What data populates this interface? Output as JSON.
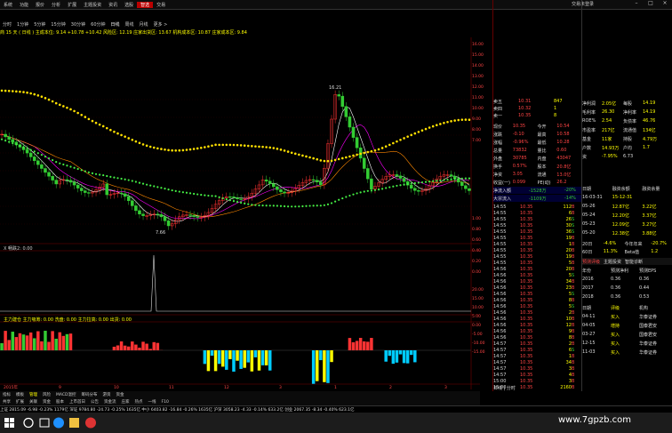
{
  "menu": [
    "系统",
    "功能",
    "报价",
    "分析",
    "扩展",
    "主题投资",
    "资讯",
    "选股",
    "智选",
    "交易"
  ],
  "menu_active_index": 8,
  "window_title": "交易未登录",
  "period_tabs": [
    "分时",
    "1分钟",
    "5分钟",
    "15分钟",
    "30分钟",
    "60分钟",
    "日线",
    "周线",
    "月线",
    "更多 >"
  ],
  "period_active_index": 6,
  "indicator_line": "商 15 天 ( 日线 ) 主成本位: 9.14  +10.78  +10.42  风险区: 12.19  庄家出货区: 13.67  机构成本区: 10.87  庄家成本区: 9.84",
  "price_labels": {
    "high": "16.21",
    "low": "7.66"
  },
  "sub1_title": "X 畅跌2: 0.00",
  "sub2_title": "主力建仓  主力吸筹: 0.00  洗盘: 0.00          主力拉高: 0.00  出货: 0.00",
  "date_axis": [
    "2015年",
    "9",
    "10",
    "11",
    "12",
    "3",
    "1",
    "2",
    "3"
  ],
  "right_axis_ticks": [
    "16.00",
    "15.00",
    "14.00",
    "13.00",
    "12.00",
    "11.00",
    "10.00",
    "9.00",
    "8.00",
    "7.00",
    "1.00",
    "0.80",
    "0.60",
    "0.40",
    "0.20",
    "0.00",
    "20.00",
    "15.00",
    "10.00",
    "5.00",
    "0.00",
    "-5.00",
    "-10.00",
    "-15.00"
  ],
  "quote": {
    "sell_rows": [
      {
        "label": "卖五",
        "price": "10.31",
        "vol": "847"
      },
      {
        "label": "卖四",
        "price": "10.32",
        "vol": "1"
      },
      {
        "label": "卖一",
        "price": "10.35",
        "vol": "8"
      }
    ],
    "info": [
      [
        "现价",
        "10.35",
        "今开",
        "10.54"
      ],
      [
        "涨跌",
        "-0.10",
        "最高",
        "10.58"
      ],
      [
        "涨幅",
        "-0.96%",
        "最低",
        "10.28"
      ],
      [
        "总量",
        "73832",
        "量比",
        "0.60"
      ],
      [
        "外盘",
        "30785",
        "内盘",
        "43047"
      ],
      [
        "换手",
        "0.57%",
        "股本",
        "20.8亿"
      ],
      [
        "净资",
        "3.05",
        "流通",
        "13.0亿"
      ],
      [
        "收益(一)",
        "0.099",
        "PE(动)",
        "26.2"
      ]
    ],
    "flows": [
      {
        "label": "净流入额",
        "value": "-1528万",
        "pct": "-20%"
      },
      {
        "label": "大宗流入",
        "value": "-1109万",
        "pct": "-14%"
      }
    ],
    "ticks": [
      [
        "14:55",
        "10.35",
        "112",
        "B"
      ],
      [
        "14:55",
        "10.35",
        "6",
        "B"
      ],
      [
        "14:55",
        "10.35",
        "26",
        "S"
      ],
      [
        "14:55",
        "10.35",
        "30",
        "S"
      ],
      [
        "14:55",
        "10.35",
        "36",
        "S"
      ],
      [
        "14:55",
        "10.35",
        "19",
        "B"
      ],
      [
        "14:55",
        "10.35",
        "1",
        "B"
      ],
      [
        "14:55",
        "10.35",
        "20",
        "B"
      ],
      [
        "14:55",
        "10.35",
        "19",
        "B"
      ],
      [
        "14:55",
        "10.35",
        "5",
        "B"
      ],
      [
        "14:56",
        "10.35",
        "20",
        "B"
      ],
      [
        "14:56",
        "10.35",
        "5",
        "S"
      ],
      [
        "14:56",
        "10.35",
        "34",
        "B"
      ],
      [
        "14:56",
        "10.35",
        "23",
        "B"
      ],
      [
        "14:56",
        "10.35",
        "5",
        "S"
      ],
      [
        "14:56",
        "10.35",
        "8",
        "B"
      ],
      [
        "14:56",
        "10.35",
        "5",
        "S"
      ],
      [
        "14:56",
        "10.35",
        "2",
        "B"
      ],
      [
        "14:56",
        "10.35",
        "10",
        "B"
      ],
      [
        "14:56",
        "10.35",
        "12",
        "B"
      ],
      [
        "14:56",
        "10.35",
        "9",
        "B"
      ],
      [
        "14:56",
        "10.35",
        "8",
        "B"
      ],
      [
        "14:57",
        "10.35",
        "2",
        "B"
      ],
      [
        "14:57",
        "10.35",
        "6",
        "S"
      ],
      [
        "14:57",
        "10.35",
        "1",
        "B"
      ],
      [
        "14:57",
        "10.35",
        "34",
        "B"
      ],
      [
        "14:57",
        "10.35",
        "3",
        "B"
      ],
      [
        "14:57",
        "10.35",
        "4",
        "B"
      ],
      [
        "15:00",
        "10.35",
        "3",
        "B"
      ],
      [
        "15:00",
        "10.35",
        "2160",
        "B"
      ]
    ],
    "footer": "日线 | 分时"
  },
  "fund": {
    "top": [
      [
        "净利润",
        "2.05亿",
        "每股",
        "14.19"
      ],
      [
        "毛利率",
        "26.30",
        "净利率",
        "14.19"
      ],
      [
        "ROE%",
        "2.54",
        "负债率",
        "46.76"
      ],
      [
        "市盈率",
        "217亿",
        "流通值",
        "134亿"
      ],
      [
        "基金",
        "11家",
        "持股",
        "4.79万"
      ],
      [
        "户数",
        "14.93万",
        "户均",
        "1.7"
      ],
      [
        "资",
        "-7.95%",
        "6.73"
      ]
    ],
    "table_header": [
      "日期",
      "融资余额",
      "融资余量"
    ],
    "table_rows": [
      [
        "16-03-31",
        "15-12-31",
        ""
      ],
      [
        "05-26",
        "12.87亿",
        "3.22亿"
      ],
      [
        "05-24",
        "12.20亿",
        "3.37亿"
      ],
      [
        "05-23",
        "12.09亿",
        "3.27亿"
      ],
      [
        "05-20",
        "12.38亿",
        "3.88亿"
      ]
    ],
    "beta": [
      [
        "20日",
        "-4.6%",
        "今年年来",
        "-20.7%"
      ],
      [
        "60日",
        "11.3%",
        "Beta值",
        "1.2"
      ]
    ],
    "tabs": [
      "预测评级",
      "主题投资",
      "智能诊断"
    ],
    "forecast_header": [
      "年份",
      "预测净利",
      "预测EPS"
    ],
    "forecast": [
      [
        "2016",
        "0.36",
        "0.36"
      ],
      [
        "2017",
        "0.36",
        "0.44"
      ],
      [
        "2018",
        "0.36",
        "0.53"
      ]
    ],
    "rating_header": [
      "日期",
      "评级",
      "机构"
    ],
    "ratings": [
      [
        "04-11",
        "买入",
        "华泰证券"
      ],
      [
        "04-05",
        "增持",
        "国泰君安"
      ],
      [
        "03-27",
        "买入",
        "国泰君安"
      ],
      [
        "12-15",
        "买入",
        "华泰证券"
      ],
      [
        "11-03",
        "买入",
        "华泰证券"
      ]
    ]
  },
  "bottom_tabs": [
    "指标",
    "模板",
    "管理",
    "风险",
    "MACD温控",
    "筹码分布",
    "游资",
    "资金"
  ],
  "bottom_tabs2": [
    "共享",
    "扩展",
    "关联",
    "资金",
    "股本",
    "上市首日",
    "公告",
    "资金流",
    "庄家",
    "热点",
    "一线",
    "F10"
  ],
  "index_bar": "上证 2815.09  -6.98  -0.23%  1179亿   深证 9784.80  -24.73  -0.25%  1635亿   中小 6403.82  -16.84  -0.26%  1635亿   沪深 3058.23  -4.33  -0.14%  633.2亿   创业 2067.35  -8.34  -0.40%  623.1亿",
  "watermark": "www.7gpzb.com",
  "colors": {
    "up": "#ff3333",
    "down": "#33cc33",
    "ma_yellow": "#ffe000",
    "ma_green": "#44ee44"
  }
}
